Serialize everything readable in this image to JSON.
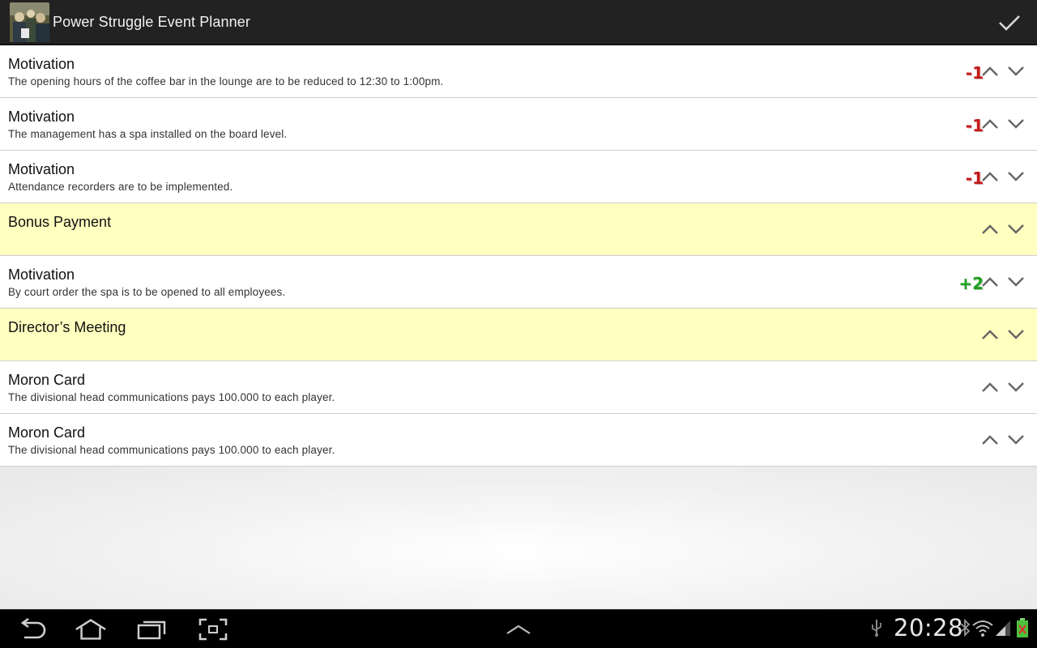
{
  "app": {
    "title": "Power Struggle Event Planner",
    "icon": "app-thumbnail-icon",
    "confirm_icon": "checkmark-icon"
  },
  "events": [
    {
      "title": "Motivation",
      "description": "The opening hours of the coffee bar in the lounge are to be reduced to 12:30 to 1:00pm.",
      "modifier": "-1",
      "highlight": false
    },
    {
      "title": "Motivation",
      "description": "The management has a spa installed on the board level.",
      "modifier": "-1",
      "highlight": false
    },
    {
      "title": "Motivation",
      "description": "Attendance recorders are to be implemented.",
      "modifier": "-1",
      "highlight": false
    },
    {
      "title": "Bonus Payment",
      "description": "",
      "modifier": "",
      "highlight": true
    },
    {
      "title": "Motivation",
      "description": "By court order the spa is to be opened to all employees.",
      "modifier": "+2",
      "highlight": false
    },
    {
      "title": "Director’s Meeting",
      "description": "",
      "modifier": "",
      "highlight": true
    },
    {
      "title": "Moron Card",
      "description": "The divisional head communications pays 100.000 to each player.",
      "modifier": "",
      "highlight": false
    },
    {
      "title": "Moron Card",
      "description": "The divisional head communications pays 100.000 to each player.",
      "modifier": "",
      "highlight": false
    }
  ],
  "colors": {
    "highlight_row": "#ffffc0",
    "negative": "#c41a1a",
    "positive": "#1ea01e",
    "action_bar": "#222222"
  },
  "system_bar": {
    "time": "20:28",
    "nav_icons": [
      "back-icon",
      "home-icon",
      "recent-apps-icon",
      "screenshot-icon",
      "menu-up-icon"
    ],
    "status_icons": [
      "usb-icon",
      "bluetooth-icon",
      "wifi-icon",
      "signal-icon",
      "battery-icon"
    ]
  }
}
